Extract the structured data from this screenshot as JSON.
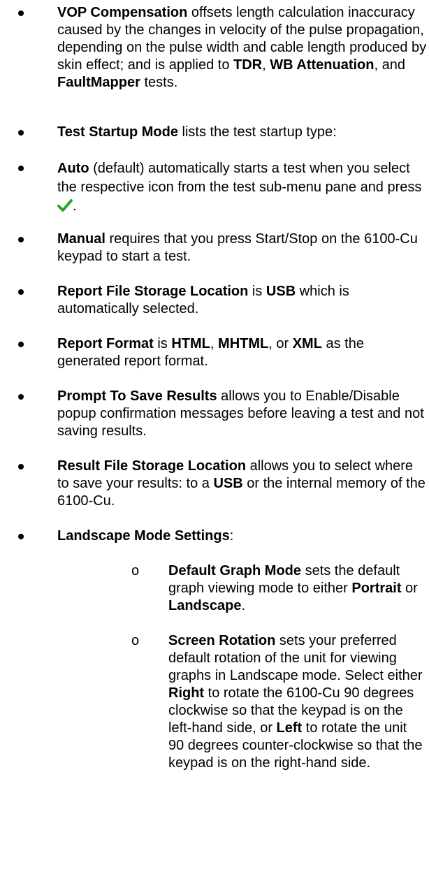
{
  "bullets": [
    {
      "segments": [
        {
          "t": "VOP Compensation",
          "b": true
        },
        {
          "t": " offsets length calculation inaccuracy caused by the changes in velocity of the pulse propagation, depending on the pulse width and cable length produced by skin effect; and is applied to ",
          "b": false
        },
        {
          "t": "TDR",
          "b": true
        },
        {
          "t": ", ",
          "b": false
        },
        {
          "t": "WB Attenuation",
          "b": true
        },
        {
          "t": ", and ",
          "b": false
        },
        {
          "t": "FaultMapper",
          "b": true
        },
        {
          "t": " tests.",
          "b": false
        }
      ]
    },
    {
      "segments": [
        {
          "t": "Test Startup Mode",
          "b": true
        },
        {
          "t": " lists the test startup type:",
          "b": false
        }
      ]
    },
    {
      "segments": [
        {
          "t": "Auto",
          "b": true
        },
        {
          "t": " (default) automatically starts a test when you select the respective icon from the test sub-menu pane and press ",
          "b": false
        },
        {
          "icon": "checkmark-icon"
        },
        {
          "t": ".",
          "b": false
        }
      ]
    },
    {
      "segments": [
        {
          "t": "Manual",
          "b": true
        },
        {
          "t": " requires that you press Start/Stop on the 6100-Cu keypad to start a test.",
          "b": false
        }
      ]
    },
    {
      "segments": [
        {
          "t": "Report File Storage Location",
          "b": true
        },
        {
          "t": " is ",
          "b": false
        },
        {
          "t": "USB",
          "b": true
        },
        {
          "t": " which is automatically selected.",
          "b": false
        }
      ]
    },
    {
      "segments": [
        {
          "t": "Report Format",
          "b": true
        },
        {
          "t": " is ",
          "b": false
        },
        {
          "t": "HTML",
          "b": true
        },
        {
          "t": ", ",
          "b": false
        },
        {
          "t": "MHTML",
          "b": true
        },
        {
          "t": ", or ",
          "b": false
        },
        {
          "t": "XML",
          "b": true
        },
        {
          "t": " as the generated report format.",
          "b": false
        }
      ]
    },
    {
      "segments": [
        {
          "t": "Prompt To Save Results",
          "b": true
        },
        {
          "t": " allows you to Enable/Disable popup confirmation messages before leaving a test and not saving results.",
          "b": false
        }
      ]
    },
    {
      "segments": [
        {
          "t": "Result File Storage Location",
          "b": true
        },
        {
          "t": " allows you to select where to save your results: to a ",
          "b": false
        },
        {
          "t": "USB",
          "b": true
        },
        {
          "t": " or the internal memory of the 6100-Cu.",
          "b": false
        }
      ]
    },
    {
      "segments": [
        {
          "t": "Landscape Mode Settings",
          "b": true
        },
        {
          "t": ":",
          "b": false
        }
      ]
    }
  ],
  "subbullet_marker": "o",
  "subbullets": [
    {
      "segments": [
        {
          "t": "Default Graph Mode",
          "b": true
        },
        {
          "t": " sets the default graph viewing mode to either ",
          "b": false
        },
        {
          "t": "Portrait",
          "b": true
        },
        {
          "t": " or ",
          "b": false
        },
        {
          "t": "Landscape",
          "b": true
        },
        {
          "t": ".",
          "b": false
        }
      ]
    },
    {
      "segments": [
        {
          "t": "Screen Rotation",
          "b": true
        },
        {
          "t": " sets your preferred default rotation of the unit for viewing graphs in Landscape mode. Select either ",
          "b": false
        },
        {
          "t": "Right",
          "b": true
        },
        {
          "t": " to rotate the 6100-Cu 90 degrees clockwise so that the keypad is on the left-hand side, or ",
          "b": false
        },
        {
          "t": "Left",
          "b": true
        },
        {
          "t": " to rotate the unit 90 degrees counter-clockwise so that the keypad is on the right-hand side.",
          "b": false
        }
      ]
    }
  ],
  "colors": {
    "checkmark": "#2aa52a",
    "text": "#000000"
  }
}
